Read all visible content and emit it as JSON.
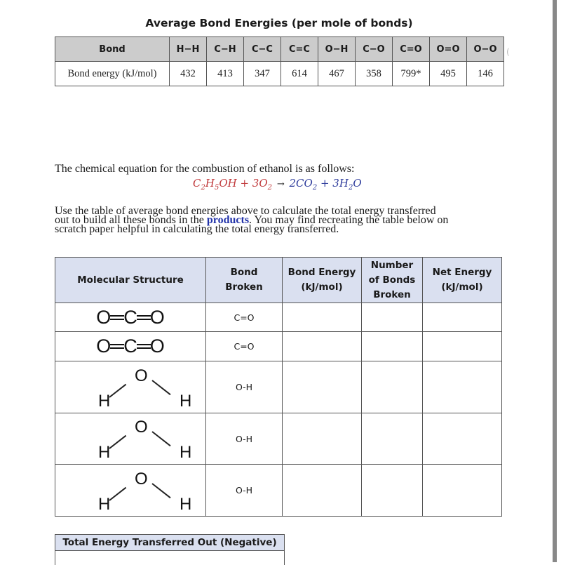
{
  "bond_table": {
    "title": "Average Bond Energies (per mole of bonds)",
    "header_label": "Bond",
    "row_label": "Bond energy (kJ/mol)",
    "bonds": [
      "H−H",
      "C−H",
      "C−C",
      "C=C",
      "O−H",
      "C−O",
      "C=O",
      "O=O",
      "O−O"
    ],
    "energies": [
      "432",
      "413",
      "347",
      "614",
      "467",
      "358",
      "799*",
      "495",
      "146"
    ]
  },
  "intro_text": "The chemical equation for the combustion of ethanol is as follows:",
  "equation": {
    "reactants": [
      "C",
      "2",
      "H",
      "5",
      "OH + 3O",
      "2"
    ],
    "arrow": "→",
    "products": [
      "2CO",
      "2",
      " + 3H",
      "2",
      "O"
    ],
    "reactant_color": "#c0393b",
    "product_color": "#2f3d9c"
  },
  "instructions": {
    "line1": "Use the table of average bond energies above to calculate the total energy transferred",
    "line2_before": "out to build all these bonds in the ",
    "line2_highlight": "products",
    "line2_after": ". You may find recreating the table below on",
    "line3": "scratch paper helpful in calculating the total energy transferred."
  },
  "mol_table": {
    "headers": {
      "structure": "Molecular Structure",
      "bond_broken": [
        "Bond",
        "Broken"
      ],
      "bond_energy": [
        "Bond Energy",
        "(kJ/mol)"
      ],
      "num_bonds": [
        "Number",
        "of Bonds",
        "Broken"
      ],
      "net_energy": [
        "Net Energy",
        "(kJ/mol)"
      ]
    },
    "rows": [
      {
        "molecule": "CO2",
        "atoms": [
          "O",
          "C",
          "O"
        ],
        "bond_broken": "C=O",
        "bond_energy": "",
        "num_bonds": "",
        "net_energy": ""
      },
      {
        "molecule": "CO2",
        "atoms": [
          "O",
          "C",
          "O"
        ],
        "bond_broken": "C=O",
        "bond_energy": "",
        "num_bonds": "",
        "net_energy": ""
      },
      {
        "molecule": "H2O",
        "atoms": [
          "H",
          "O",
          "H"
        ],
        "bond_broken": "O-H",
        "bond_energy": "",
        "num_bonds": "",
        "net_energy": ""
      },
      {
        "molecule": "H2O",
        "atoms": [
          "H",
          "O",
          "H"
        ],
        "bond_broken": "O-H",
        "bond_energy": "",
        "num_bonds": "",
        "net_energy": ""
      },
      {
        "molecule": "H2O",
        "atoms": [
          "H",
          "O",
          "H"
        ],
        "bond_broken": "O-H",
        "bond_energy": "",
        "num_bonds": "",
        "net_energy": ""
      }
    ]
  },
  "total_box": {
    "label": "Total Energy Transferred Out (Negative)",
    "value": ""
  }
}
